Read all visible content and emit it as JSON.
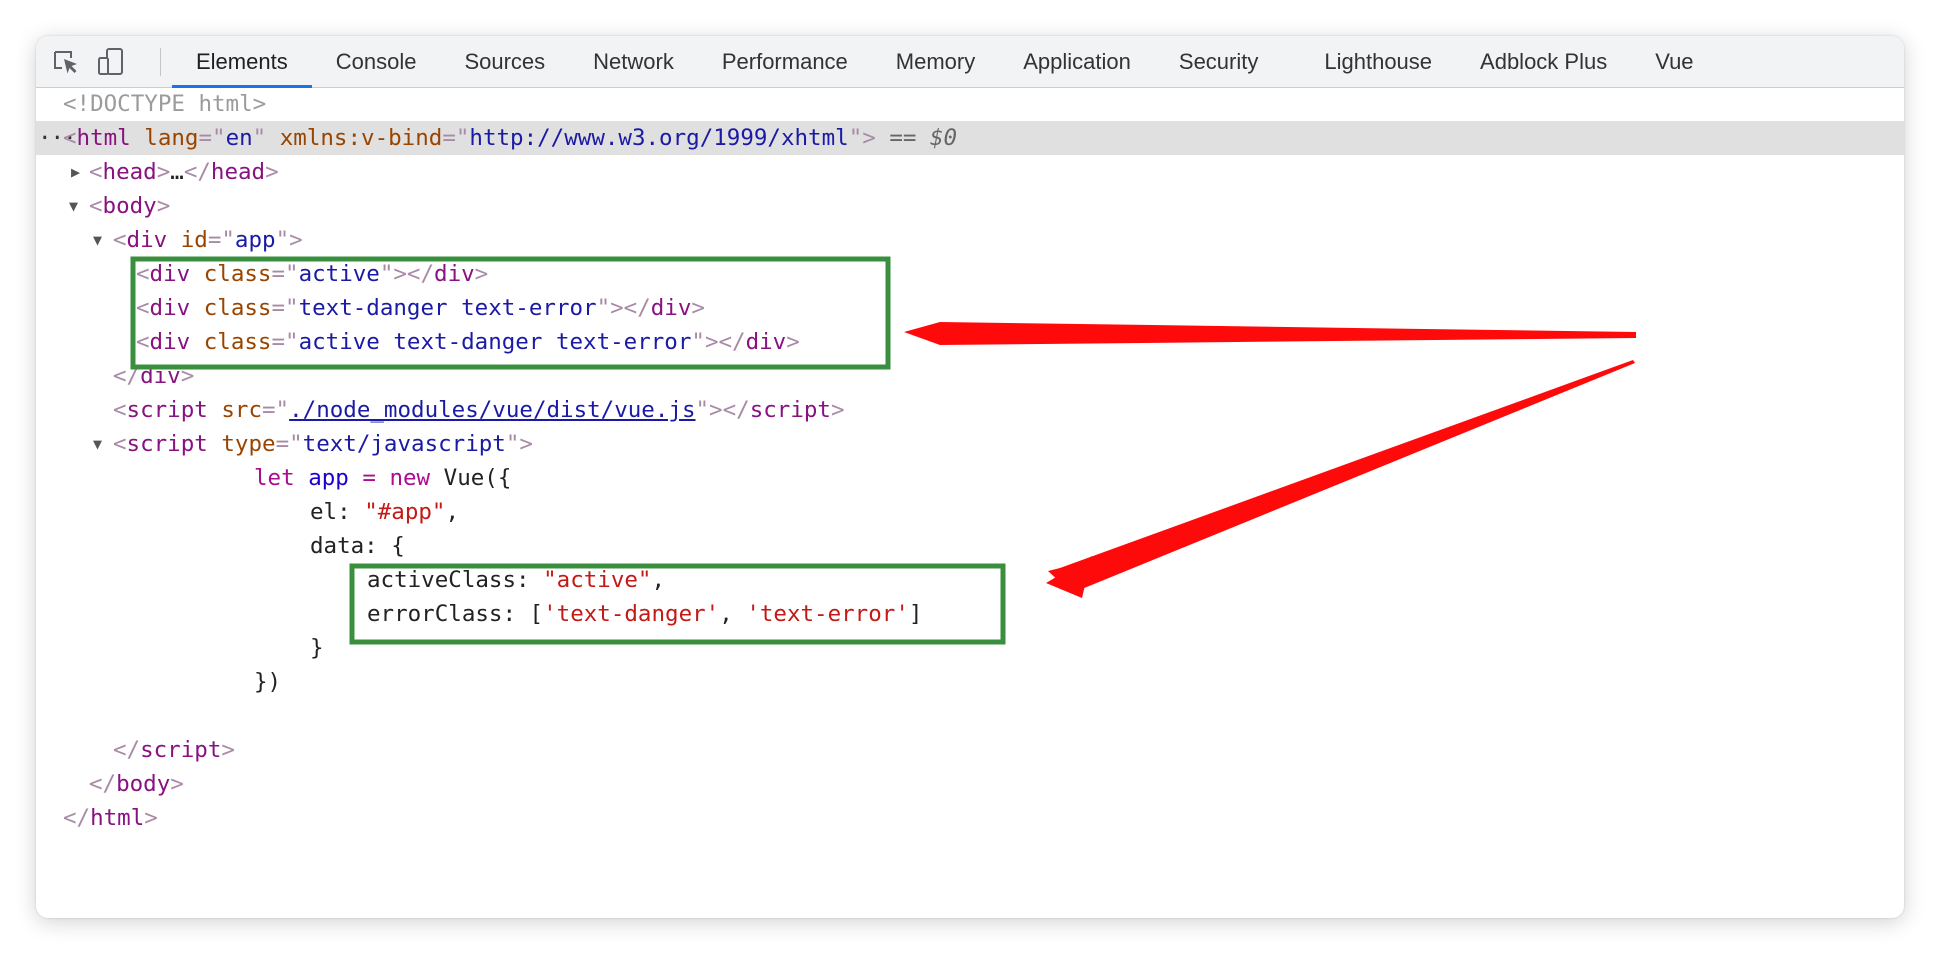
{
  "tabs": [
    "Elements",
    "Console",
    "Sources",
    "Network",
    "Performance",
    "Memory",
    "Application",
    "Security",
    "Lighthouse",
    "Adblock Plus",
    "Vue"
  ],
  "icons": {
    "inspect": "inspect-element-icon",
    "device": "device-toolbar-icon"
  },
  "code": {
    "doctype": "<!DOCTYPE html>",
    "html_open": {
      "tag": "html",
      "attr1": "lang",
      "val1": "en",
      "attr2": "xmlns:v-bind",
      "val2": "http://www.w3.org/1999/xhtml",
      "marker": "== $0"
    },
    "head": {
      "open": "head",
      "ellipsis": "…",
      "close": "head"
    },
    "body_open": "body",
    "div_app": {
      "tag": "div",
      "attr": "id",
      "val": "app"
    },
    "child_divs": [
      {
        "tag": "div",
        "attr": "class",
        "val": "active"
      },
      {
        "tag": "div",
        "attr": "class",
        "val": "text-danger text-error"
      },
      {
        "tag": "div",
        "attr": "class",
        "val": "active text-danger text-error"
      }
    ],
    "div_close": "div",
    "script_src": {
      "tag": "script",
      "attr": "src",
      "val": "./node_modules/vue/dist/vue.js"
    },
    "script_inline": {
      "tag": "script",
      "attr": "type",
      "val": "text/javascript"
    },
    "js": {
      "kw_let": "let",
      "var_app": "app",
      "op_eq": "=",
      "kw_new": "new",
      "ctor": "Vue({",
      "el_key": "el:",
      "el_val": "\"#app\"",
      "comma": ",",
      "data_key": "data: {",
      "active_key": "activeClass:",
      "active_val": "\"active\"",
      "error_key": "errorClass: [",
      "error_val1": "'text-danger'",
      "error_val2": "'text-error'",
      "error_end": "]",
      "close_brace": "}",
      "close_call": "})"
    },
    "script_close": "script",
    "body_close": "body",
    "html_close": "html"
  },
  "annotation_colors": {
    "highlight_box": "#3a8f3f",
    "arrow": "#ff0a0a",
    "selected_line": "#e0e0e0",
    "active_tab": "#1a73e8"
  }
}
